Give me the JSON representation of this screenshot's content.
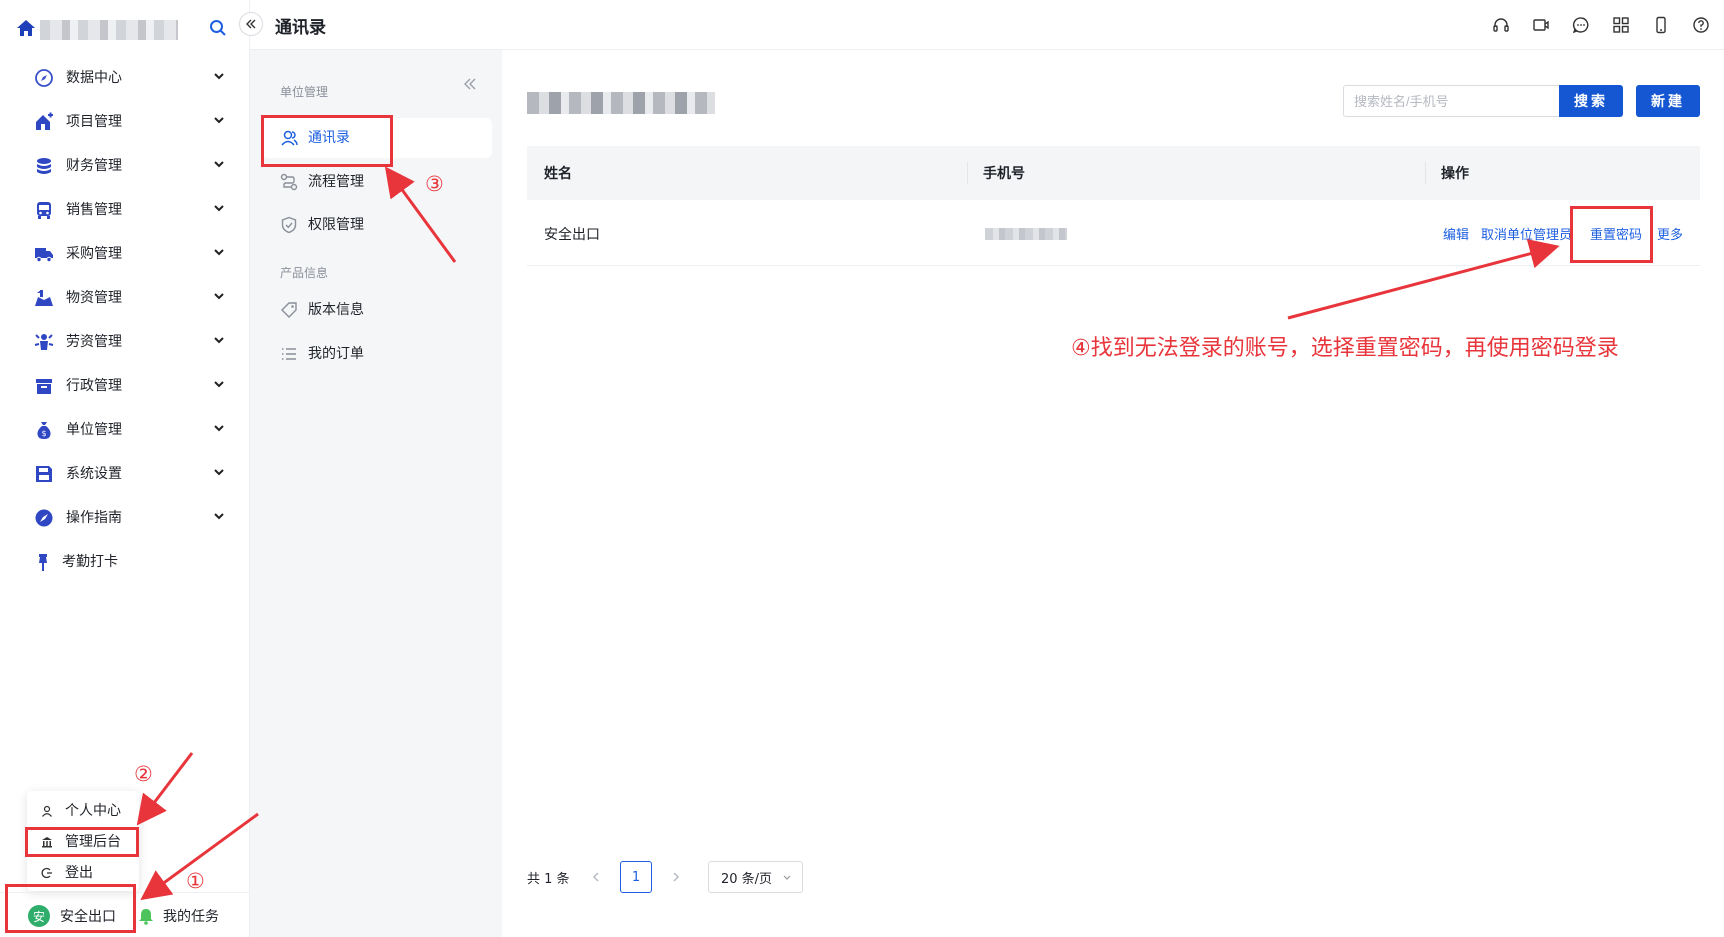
{
  "sidebar": {
    "items": [
      {
        "label": "数据中心",
        "icon": "compass-icon"
      },
      {
        "label": "项目管理",
        "icon": "house-plus-icon"
      },
      {
        "label": "财务管理",
        "icon": "coins-icon"
      },
      {
        "label": "销售管理",
        "icon": "bus-icon"
      },
      {
        "label": "采购管理",
        "icon": "truck-icon"
      },
      {
        "label": "物资管理",
        "icon": "warehouse-icon"
      },
      {
        "label": "劳资管理",
        "icon": "worker-icon"
      },
      {
        "label": "行政管理",
        "icon": "archive-icon"
      },
      {
        "label": "单位管理",
        "icon": "money-bag-icon"
      },
      {
        "label": "系统设置",
        "icon": "floppy-icon"
      },
      {
        "label": "操作指南",
        "icon": "compass-icon"
      }
    ],
    "attendance": "考勤打卡",
    "popup": {
      "profile": "个人中心",
      "admin": "管理后台",
      "logout": "登出"
    },
    "user_name": "安全出口",
    "user_avatar": "安",
    "tasks": "我的任务"
  },
  "header": {
    "title": "通讯录",
    "icons": [
      "headset-icon",
      "video-icon",
      "chat-icon",
      "apps-icon",
      "phone-icon",
      "help-icon"
    ]
  },
  "subnav": {
    "group1": "单位管理",
    "items1": [
      "通讯录",
      "流程管理",
      "权限管理"
    ],
    "group2": "产品信息",
    "items2": [
      "版本信息",
      "我的订单"
    ]
  },
  "main": {
    "search_placeholder": "搜索姓名/手机号",
    "search_button": "搜索",
    "new_button": "新建",
    "columns": [
      "姓名",
      "手机号",
      "操作"
    ],
    "rows": [
      {
        "name": "安全出口"
      }
    ],
    "actions": [
      "编辑",
      "取消单位管理员",
      "重置密码",
      "更多"
    ],
    "pagination": {
      "total": "共 1 条",
      "page": "1",
      "page_size": "20 条/页"
    }
  },
  "annotations": {
    "step1": "①",
    "step2": "②",
    "step3": "③",
    "step4_text": "④找到无法登录的账号，选择重置密码，再使用密码登录"
  },
  "colors": {
    "primary": "#1557d2",
    "link": "#1d5fe0",
    "annotation": "#e8353b",
    "subnav_bg": "#f5f6f8"
  }
}
